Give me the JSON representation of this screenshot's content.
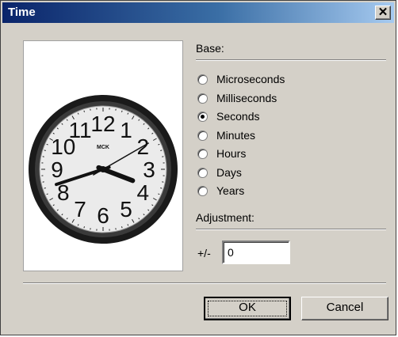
{
  "window": {
    "title": "Time",
    "close_icon": "close-icon"
  },
  "clock": {
    "numerals": [
      "12",
      "1",
      "2",
      "3",
      "4",
      "5",
      "6",
      "7",
      "8",
      "9",
      "10",
      "11"
    ],
    "hour": 3.7,
    "minute": 42,
    "second": 10,
    "brand": "MCK"
  },
  "base": {
    "heading": "Base:",
    "options": [
      "Microseconds",
      "Milliseconds",
      "Seconds",
      "Minutes",
      "Hours",
      "Days",
      "Years"
    ],
    "selected": "Seconds"
  },
  "adjustment": {
    "heading": "Adjustment:",
    "prefix": "+/-",
    "value": "0"
  },
  "buttons": {
    "ok": "OK",
    "cancel": "Cancel"
  },
  "colors": {
    "title_start": "#0a246a",
    "title_end": "#a6caf0",
    "dialog_bg": "#d4d0c8"
  }
}
